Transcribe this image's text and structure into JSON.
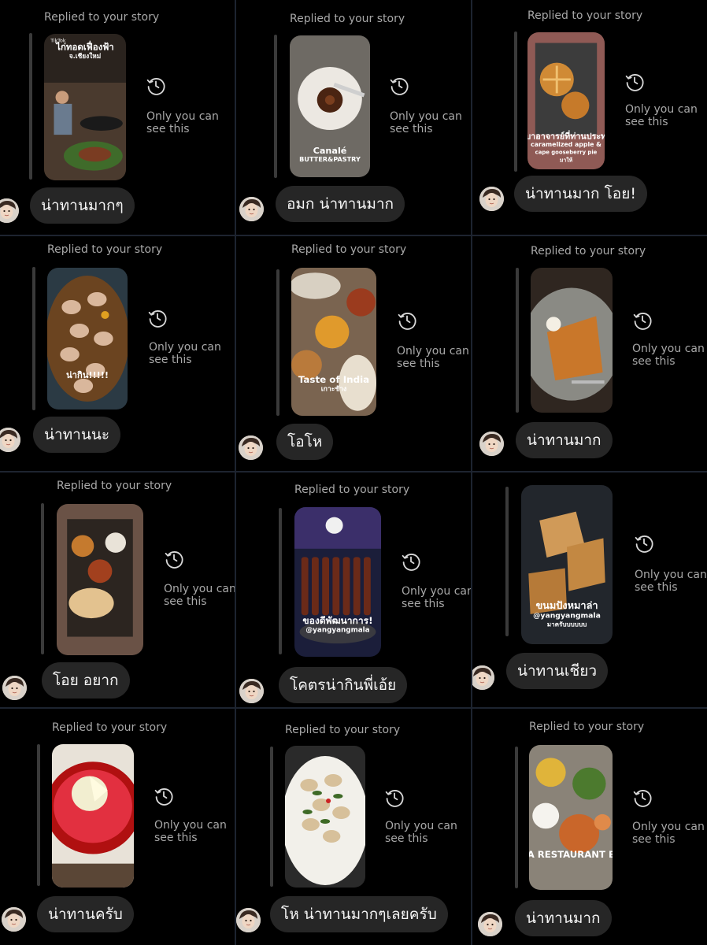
{
  "colors": {
    "background": "#000000",
    "bubble": "#262626",
    "meta_text": "#a8a8a8",
    "divider": "#1d2430"
  },
  "icons": {
    "recent": "clock-history-icon",
    "avatar": "user-avatar"
  },
  "cells": [
    {
      "header": "Replied to your story",
      "note": "Only you can\nsee this",
      "message": "น่าทานมากๆ",
      "thumb": {
        "scene": "street-food-stall",
        "overlay": [
          "ไก่ทอดเฟื่องฟ้า",
          "จ.เชียงใหม่"
        ],
        "corner": "TikTok"
      }
    },
    {
      "header": "Replied to your story",
      "note": "Only you can\nsee this",
      "message": "อมก น่าทานมาก",
      "thumb": {
        "scene": "canele-dessert",
        "overlay": [
          "Canalé",
          "BUTTER&PASTRY"
        ]
      }
    },
    {
      "header": "Replied to your story",
      "note": "Only you can\nsee this",
      "message": "น่าทานมาก โอย!",
      "thumb": {
        "scene": "apple-pies",
        "overlay": [
          "ครูบาอาจารย์ที่ท่านประทาน",
          "caramelized apple &",
          "cape gooseberry pie",
          "มาให้"
        ]
      }
    },
    {
      "header": "Replied to your story",
      "note": "Only you can\nsee this",
      "message": "น่าทานนะ",
      "thumb": {
        "scene": "stir-fry",
        "overlay": [
          "น่ากิน!!!!!"
        ]
      }
    },
    {
      "header": "Replied to your story",
      "note": "Only you can\nsee this",
      "message": "โอโห",
      "thumb": {
        "scene": "indian-platter",
        "overlay": [
          "Taste of India",
          "เกาะช้าง"
        ]
      }
    },
    {
      "header": "Replied to your story",
      "note": "Only you can\nsee this",
      "message": "น่าทานมาก",
      "thumb": {
        "scene": "toast-plate",
        "overlay": []
      }
    },
    {
      "header": "Replied to your story",
      "note": "Only you can\nsee this",
      "message": "โอย อยาก",
      "thumb": {
        "scene": "table-spread",
        "overlay": []
      }
    },
    {
      "header": "Replied to your story",
      "note": "Only you can\nsee this",
      "message": "โคตรน่ากินพี่เอ้ย",
      "thumb": {
        "scene": "skewers-night",
        "overlay": [
          "ของดีพัฒนาการ!",
          "@yangyangmala"
        ]
      }
    },
    {
      "header": "",
      "note": "Only you can\nsee this",
      "message": "น่าทานเชียว",
      "thumb": {
        "scene": "grilled-bread",
        "overlay": [
          "ขนมปังหมาล่า",
          "@yangyangmala",
          "มาครับบบบบบ"
        ]
      }
    },
    {
      "header": "Replied to your story",
      "note": "Only you can\nsee this",
      "message": "น่าทานครับ",
      "thumb": {
        "scene": "red-bowl-ice",
        "overlay": []
      }
    },
    {
      "header": "Replied to your story",
      "note": "Only you can\nsee this",
      "message": "โห น่าทานมากๆเลยครับ",
      "thumb": {
        "scene": "basil-rice",
        "overlay": []
      }
    },
    {
      "header": "Replied to your story",
      "note": "Only you can\nsee this",
      "message": "น่าทานมาก",
      "thumb": {
        "scene": "nepali-thali",
        "overlay": [
          "HIMALAYA RESTAURANT BANGKOK"
        ]
      }
    }
  ]
}
